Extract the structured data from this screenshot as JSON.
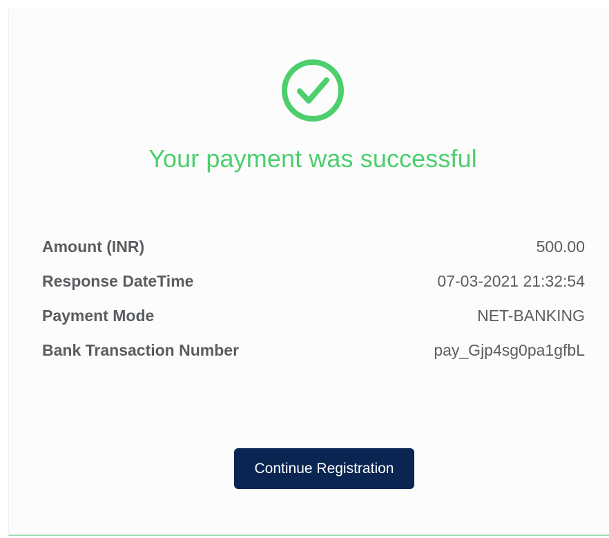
{
  "status": {
    "title": "Your payment was successful",
    "icon": "check-circle-icon",
    "color": "#4ccf6c"
  },
  "details": [
    {
      "label": "Amount (INR)",
      "value": "500.00"
    },
    {
      "label": "Response DateTime",
      "value": "07-03-2021 21:32:54"
    },
    {
      "label": "Payment Mode",
      "value": "NET-BANKING"
    },
    {
      "label": "Bank Transaction Number",
      "value": "pay_Gjp4sg0pa1gfbL"
    }
  ],
  "actions": {
    "continue_label": "Continue Registration",
    "button_color": "#0b2552"
  }
}
